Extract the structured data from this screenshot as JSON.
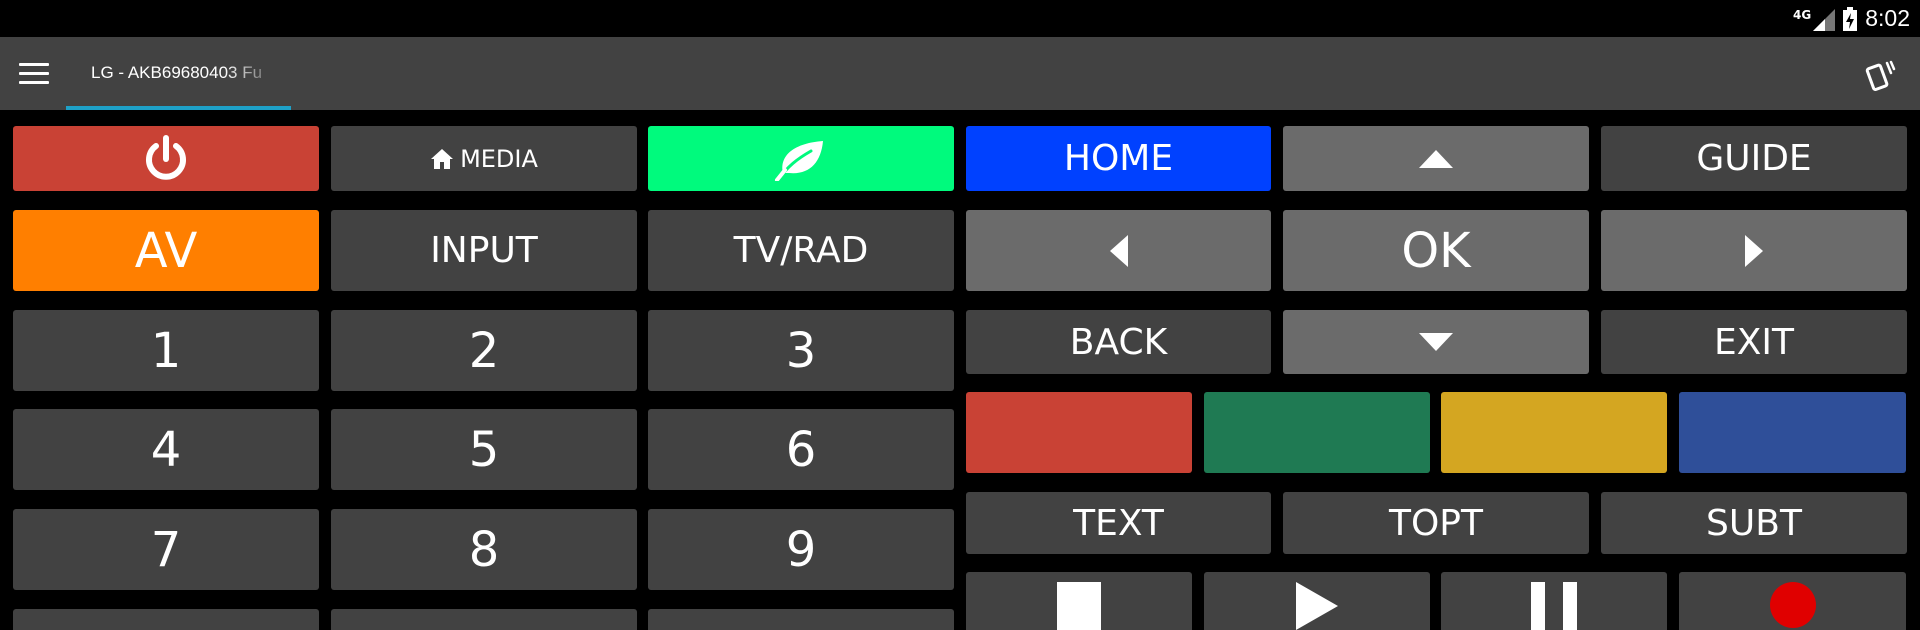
{
  "status": {
    "time": "8:02",
    "network": "4G"
  },
  "appbar": {
    "tab_label": "LG - AKB69680403 Fu"
  },
  "buttons": {
    "media": "MEDIA",
    "home": "HOME",
    "guide": "GUIDE",
    "av": "AV",
    "input": "INPUT",
    "tv_rad": "TV/RAD",
    "ok": "OK",
    "back": "BACK",
    "exit": "EXIT",
    "text": "TEXT",
    "topt": "TOPT",
    "subt": "SUBT",
    "digits": [
      "1",
      "2",
      "3",
      "4",
      "5",
      "6",
      "7",
      "8",
      "9"
    ]
  },
  "colors": {
    "power": "#c94235",
    "eco": "#00fa7d",
    "home": "#0041ff",
    "av": "#ff7f00",
    "red": "#c94235",
    "green": "#1f7a53",
    "yellow": "#d4a621",
    "blue": "#2f4f99",
    "record": "#e00000"
  },
  "icons": {
    "power": "power-icon",
    "media_home": "house-icon",
    "eco": "leaf-icon",
    "up": "triangle-up-icon",
    "down": "triangle-down-icon",
    "left": "triangle-left-icon",
    "right": "triangle-right-icon",
    "stop": "stop-icon",
    "play": "play-icon",
    "pause": "pause-icon",
    "record": "record-icon"
  }
}
